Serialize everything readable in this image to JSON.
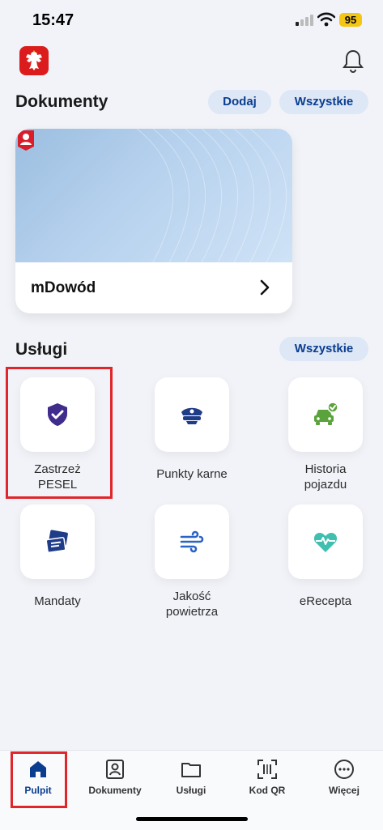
{
  "status": {
    "time": "15:47",
    "battery": "95"
  },
  "documents": {
    "title": "Dokumenty",
    "add_label": "Dodaj",
    "all_label": "Wszystkie",
    "card": {
      "name": "mDowód"
    }
  },
  "services": {
    "title": "Usługi",
    "all_label": "Wszystkie",
    "items": [
      {
        "label": "Zastrzeż\nPESEL",
        "icon": "shield-check-icon"
      },
      {
        "label": "Punkty karne",
        "icon": "police-cap-icon"
      },
      {
        "label": "Historia\npojazdu",
        "icon": "car-check-icon"
      },
      {
        "label": "Mandaty",
        "icon": "tickets-icon"
      },
      {
        "label": "Jakość\npowietrza",
        "icon": "wind-icon"
      },
      {
        "label": "eRecepta",
        "icon": "heart-pulse-icon"
      }
    ]
  },
  "tabs": [
    {
      "label": "Pulpit",
      "icon": "home-icon"
    },
    {
      "label": "Dokumenty",
      "icon": "id-card-icon"
    },
    {
      "label": "Usługi",
      "icon": "folder-icon"
    },
    {
      "label": "Kod QR",
      "icon": "qr-scan-icon"
    },
    {
      "label": "Więcej",
      "icon": "more-icon"
    }
  ],
  "colors": {
    "accent": "#0a3d8f",
    "pill_bg": "#dde7f6",
    "highlight": "#e0262b",
    "emblem": "#dc1c1c"
  }
}
